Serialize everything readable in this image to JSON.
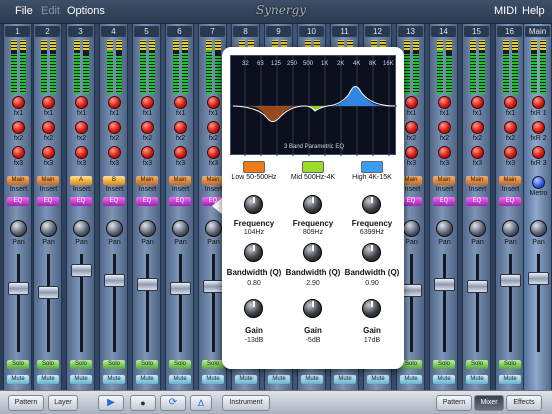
{
  "menu": {
    "file": "File",
    "edit": "Edit",
    "options": "Options",
    "logo": "Synergy",
    "midi": "MIDI",
    "help": "Help"
  },
  "channels": {
    "labels": [
      "1",
      "2",
      "3",
      "4",
      "5",
      "6",
      "7",
      "8",
      "9",
      "10",
      "11",
      "12",
      "13",
      "14",
      "15",
      "16"
    ],
    "master": "Main"
  },
  "strip": {
    "fx1": "fx1",
    "fx2": "fx2",
    "fx3": "fx3",
    "main": "Main",
    "a": "A",
    "b": "B",
    "insert": "Insert",
    "eq": "EQ",
    "pan": "Pan",
    "solo": "Solo",
    "mute": "Mute",
    "fxr1": "fxR 1",
    "fxr2": "fxR 2",
    "fxr3": "fxR 3",
    "metro": "Metro"
  },
  "eq": {
    "freqs": [
      "32",
      "63",
      "125",
      "250",
      "500",
      "1K",
      "2K",
      "4K",
      "8K",
      "16K"
    ],
    "title": "3 Band Parametric EQ",
    "bands": [
      {
        "label": "Low 50-500Hz",
        "color": "#f07a1a",
        "freq_title": "Frequency",
        "freq": "104Hz",
        "bw_title": "Bandwidth (Q)",
        "bw": "0.80",
        "gain_title": "Gain",
        "gain": "-13dB"
      },
      {
        "label": "Mid 500Hz-4K",
        "color": "#9bdc2a",
        "freq_title": "Frequency",
        "freq": "809Hz",
        "bw_title": "Bandwidth (Q)",
        "bw": "2.90",
        "gain_title": "Gain",
        "gain": "-5dB"
      },
      {
        "label": "High 4K-15K",
        "color": "#3a9cf2",
        "freq_title": "Frequency",
        "freq": "6399Hz",
        "bw_title": "Bandwidth (Q)",
        "bw": "0.90",
        "gain_title": "Gain",
        "gain": "17dB"
      }
    ]
  },
  "toolbar": {
    "pattern": "Pattern",
    "layer": "Layer",
    "instrument": "Instrument",
    "play_icon": "play-icon",
    "record_icon": "record-icon",
    "loop_icon": "loop-icon",
    "metronome_icon": "metronome-icon",
    "view_pattern": "Pattern",
    "view_mixer": "Mixer",
    "view_effects": "Effects",
    "selected_view": "Mixer"
  }
}
